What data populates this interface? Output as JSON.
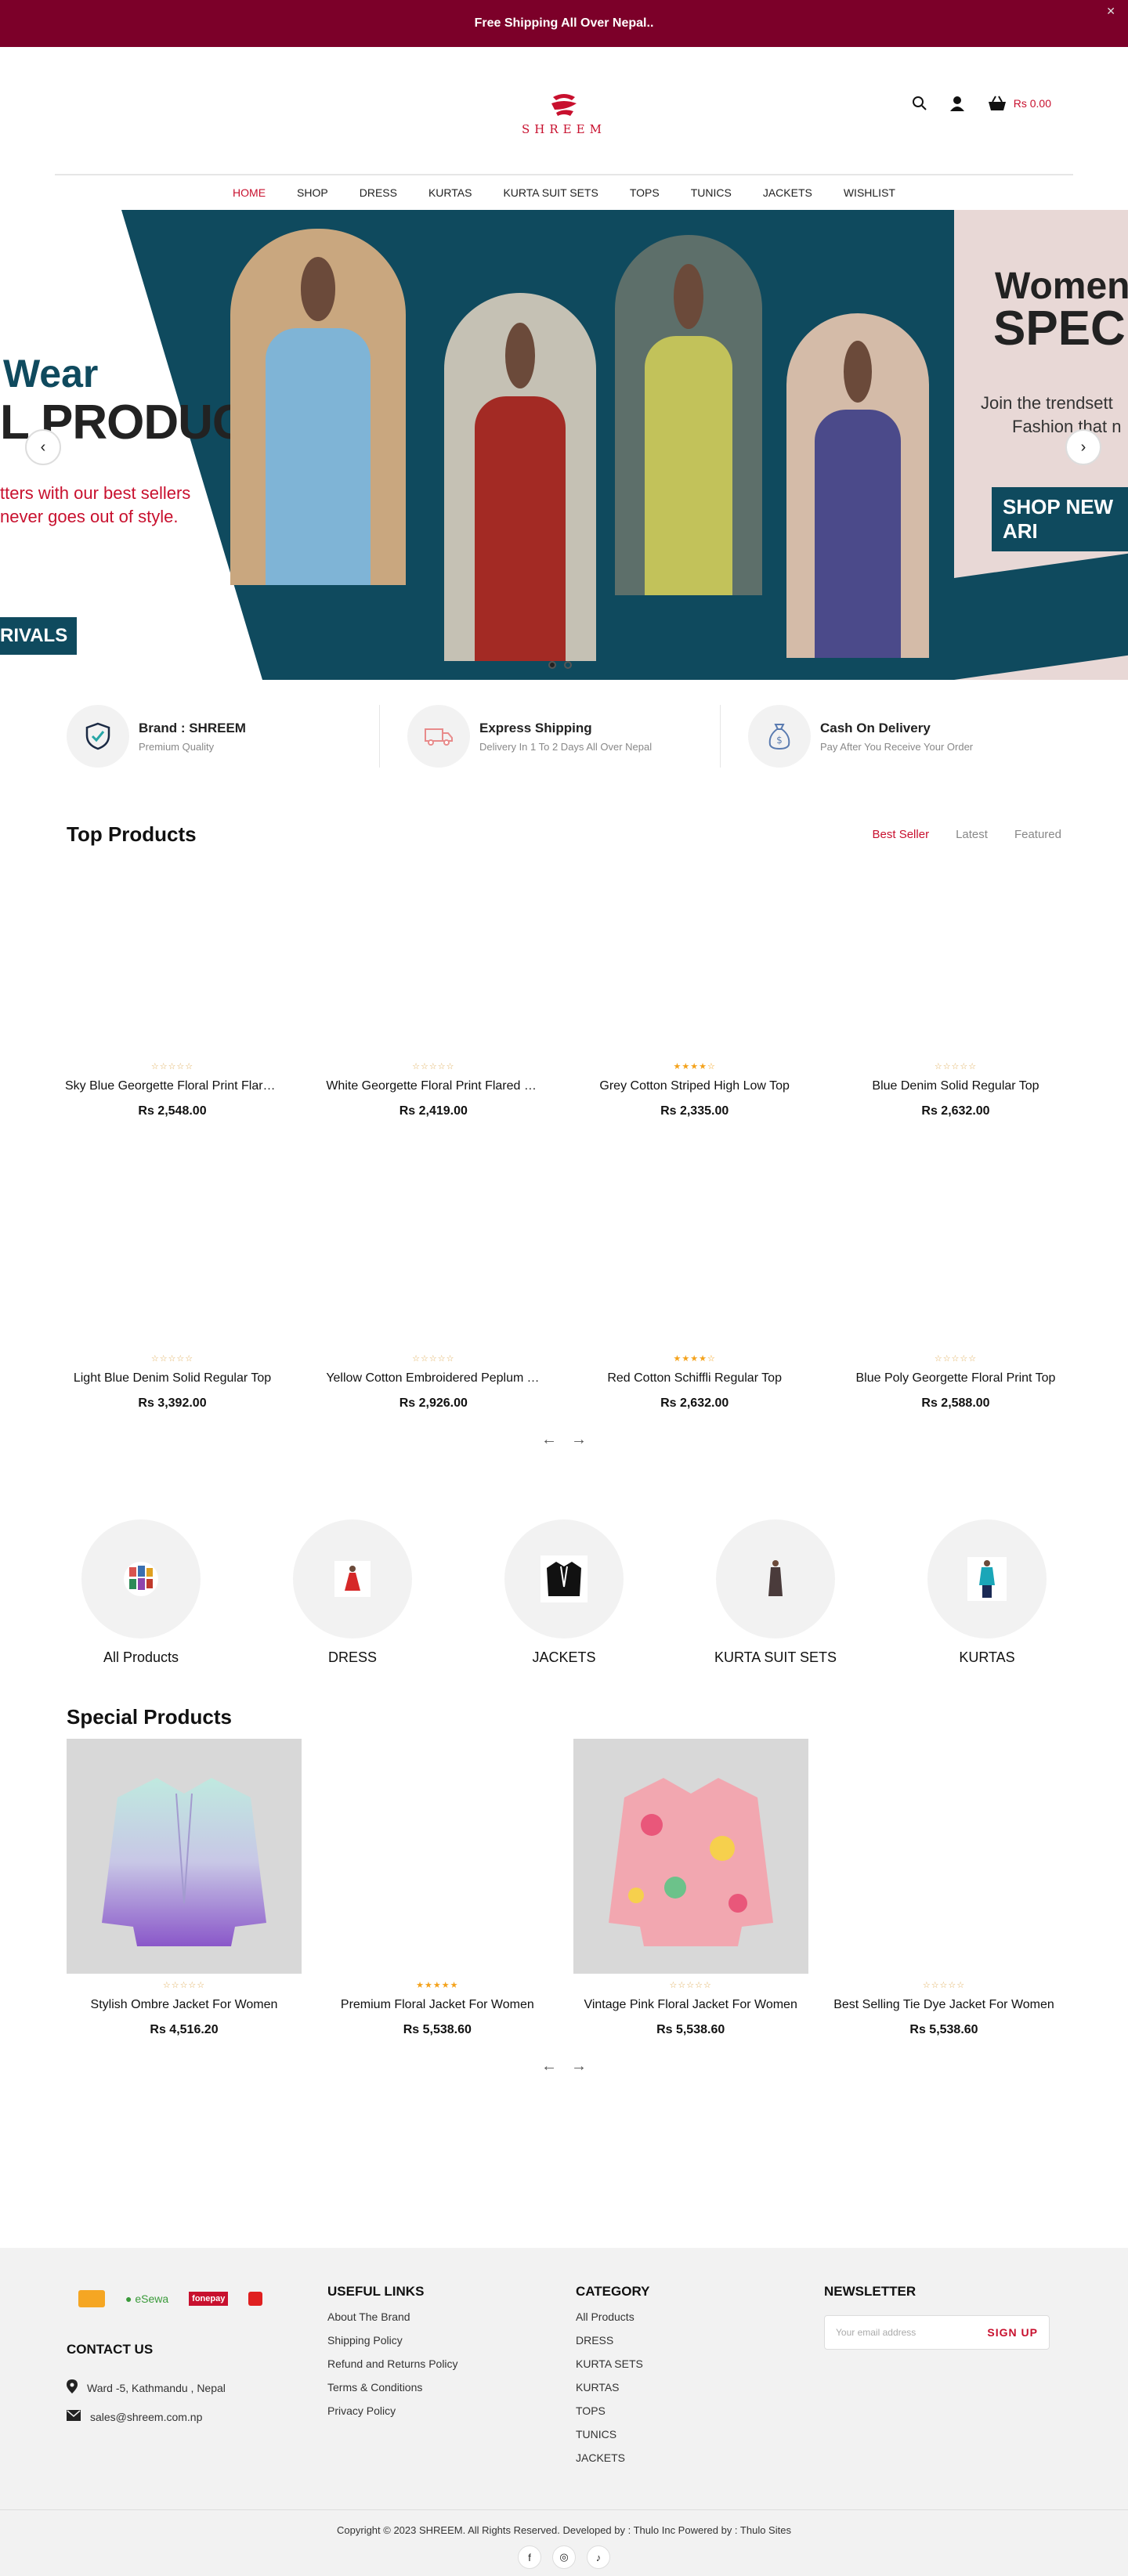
{
  "announcement": "Free Shipping All Over Nepal..",
  "header": {
    "brand": "SHREEM",
    "cart_amount": "Rs 0.00"
  },
  "nav": [
    "HOME",
    "SHOP",
    "DRESS",
    "KURTAS",
    "KURTA SUIT SETS",
    "TOPS",
    "TUNICS",
    "JACKETS",
    "WISHLIST"
  ],
  "hero": {
    "left_line1": "Wear",
    "left_line2": "L PRODUCTS",
    "left_line3": "tters with our best sellers",
    "left_line4": "never goes out of style.",
    "left_cta": "RIVALS",
    "right_line1": "Women",
    "right_line2": "SPECIAL",
    "right_line3": "Join the trendsett",
    "right_line4": "Fashion that n",
    "right_cta": "SHOP NEW ARI",
    "slides": 2,
    "active_slide": 1
  },
  "features": [
    {
      "title": "Brand : SHREEM",
      "sub": "Premium Quality",
      "icon": "shield-check-icon"
    },
    {
      "title": "Express Shipping",
      "sub": "Delivery In 1 To 2 Days All Over Nepal",
      "icon": "truck-icon"
    },
    {
      "title": "Cash On Delivery",
      "sub": "Pay After You Receive Your Order",
      "icon": "money-bag-icon"
    }
  ],
  "top_products": {
    "title": "Top Products",
    "tabs": [
      "Best Seller",
      "Latest",
      "Featured"
    ],
    "active_tab": "Best Seller",
    "items": [
      {
        "name": "Sky Blue Georgette Floral Print Flared Dress",
        "price": "Rs 2,548.00",
        "rating": 0
      },
      {
        "name": "White Georgette Floral Print Flared Dress",
        "price": "Rs 2,419.00",
        "rating": 0
      },
      {
        "name": "Grey Cotton Striped High Low Top",
        "price": "Rs 2,335.00",
        "rating": 4
      },
      {
        "name": "Blue Denim Solid Regular Top",
        "price": "Rs 2,632.00",
        "rating": 0
      },
      {
        "name": "Light Blue Denim Solid Regular Top",
        "price": "Rs 3,392.00",
        "rating": 0
      },
      {
        "name": "Yellow Cotton Embroidered Peplum Top",
        "price": "Rs 2,926.00",
        "rating": 0
      },
      {
        "name": "Red Cotton Schiffli Regular Top",
        "price": "Rs 2,632.00",
        "rating": 4
      },
      {
        "name": "Blue Poly Georgette Floral Print Top",
        "price": "Rs 2,588.00",
        "rating": 0
      }
    ]
  },
  "categories": [
    {
      "name": "All Products",
      "icon": "collage-icon"
    },
    {
      "name": "DRESS",
      "icon": "dress-icon"
    },
    {
      "name": "JACKETS",
      "icon": "jacket-icon"
    },
    {
      "name": "KURTA SUIT SETS",
      "icon": "suit-set-icon"
    },
    {
      "name": "KURTAS",
      "icon": "kurta-icon"
    }
  ],
  "special_products": {
    "title": "Special Products",
    "items": [
      {
        "name": "Stylish Ombre Jacket For Women",
        "price": "Rs 4,516.20",
        "rating": 0
      },
      {
        "name": "Premium Floral Jacket For Women",
        "price": "Rs 5,538.60",
        "rating": 5
      },
      {
        "name": "Vintage Pink Floral Jacket For Women",
        "price": "Rs 5,538.60",
        "rating": 0
      },
      {
        "name": "Best Selling Tie Dye Jacket For Women",
        "price": "Rs 5,538.60",
        "rating": 0
      }
    ]
  },
  "footer": {
    "payments": [
      "eSewa",
      "fonepay"
    ],
    "contact_title": "CONTACT US",
    "address": "Ward -5, Kathmandu , Nepal",
    "email": "sales@shreem.com.np",
    "useful_title": "USEFUL LINKS",
    "useful": [
      "About The Brand",
      "Shipping Policy",
      "Refund and Returns Policy",
      "Terms & Conditions",
      "Privacy Policy"
    ],
    "category_title": "CATEGORY",
    "category": [
      "All Products",
      "DRESS",
      "KURTA SETS",
      "KURTAS",
      "TOPS",
      "TUNICS",
      "JACKETS"
    ],
    "newsletter_title": "NEWSLETTER",
    "newsletter_placeholder": "Your email address",
    "signup": "SIGN UP",
    "copyright": "Copyright © 2023 SHREEM. All Rights Reserved. Developed by : Thulo Inc Powered by : Thulo Sites"
  },
  "colors": {
    "brand": "#7c0029",
    "accent": "#c8102e",
    "teal": "#0f4a5e",
    "star": "#f4a21b"
  }
}
